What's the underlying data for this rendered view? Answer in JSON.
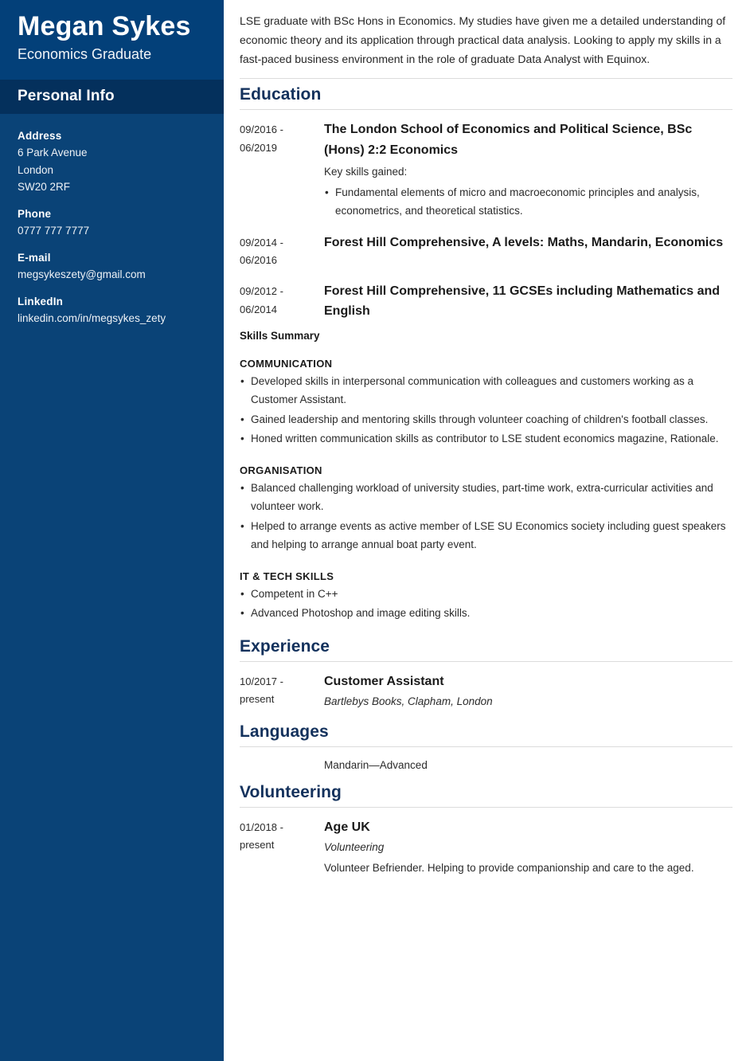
{
  "sidebar": {
    "name": "Megan Sykes",
    "job_title": "Economics Graduate",
    "personal_info_heading": "Personal Info",
    "info": [
      {
        "label": "Address",
        "lines": [
          "6 Park Avenue",
          "London",
          "SW20 2RF"
        ]
      },
      {
        "label": "Phone",
        "lines": [
          "0777 777 7777"
        ]
      },
      {
        "label": "E-mail",
        "lines": [
          "megsykeszety@gmail.com"
        ]
      },
      {
        "label": "LinkedIn",
        "lines": [
          "linkedin.com/in/megsykes_zety"
        ]
      }
    ]
  },
  "main": {
    "summary": "LSE graduate with BSc Hons in Economics. My studies have given me a detailed understanding of economic theory and its application through practical data analysis. Looking to apply my skills in a fast-paced business environment in the role of graduate Data Analyst with Equinox.",
    "sections": {
      "education": {
        "title": "Education",
        "entries": [
          {
            "date_from": "09/2016 -",
            "date_to": "06/2019",
            "heading": "The London School of Economics and Political Science, BSc (Hons) 2:2 Economics",
            "lead": "Key skills gained:",
            "bullets": [
              "Fundamental elements of micro and macroeconomic principles and analysis, econometrics, and theoretical statistics."
            ]
          },
          {
            "date_from": "09/2014 -",
            "date_to": "06/2016",
            "heading": "Forest Hill Comprehensive, A levels: Maths, Mandarin, Economics",
            "lead": "",
            "bullets": []
          },
          {
            "date_from": "09/2012 -",
            "date_to": "06/2014",
            "heading": "Forest Hill Comprehensive, 11 GCSEs including Mathematics and English",
            "lead": "",
            "bullets": []
          }
        ]
      },
      "skills": {
        "summary_label": "Skills Summary",
        "groups": [
          {
            "title": "COMMUNICATION",
            "bullets": [
              "Developed skills in interpersonal communication with colleagues and customers working as a Customer Assistant.",
              "Gained leadership and mentoring skills through volunteer coaching of children's football classes.",
              "Honed written communication skills as contributor to LSE student economics magazine, Rationale."
            ]
          },
          {
            "title": "ORGANISATION",
            "bullets": [
              "Balanced challenging workload of university studies, part-time work, extra-curricular activities and volunteer work.",
              "Helped to arrange events as active member of LSE SU Economics society including guest speakers and helping to arrange annual boat party event."
            ]
          },
          {
            "title": "IT & TECH SKILLS",
            "bullets": [
              "Competent in C++",
              "Advanced Photoshop and image editing skills."
            ]
          }
        ]
      },
      "experience": {
        "title": "Experience",
        "entries": [
          {
            "date_from": "10/2017 -",
            "date_to": "present",
            "heading": "Customer Assistant",
            "subtitle": "Bartlebys Books, Clapham, London"
          }
        ]
      },
      "languages": {
        "title": "Languages",
        "items": [
          "Mandarin—Advanced"
        ]
      },
      "volunteering": {
        "title": "Volunteering",
        "entries": [
          {
            "date_from": "01/2018 -",
            "date_to": "present",
            "heading": "Age UK",
            "subtitle": "Volunteering",
            "note": "Volunteer Befriender. Helping to provide companionship and care to the aged."
          }
        ]
      }
    }
  }
}
